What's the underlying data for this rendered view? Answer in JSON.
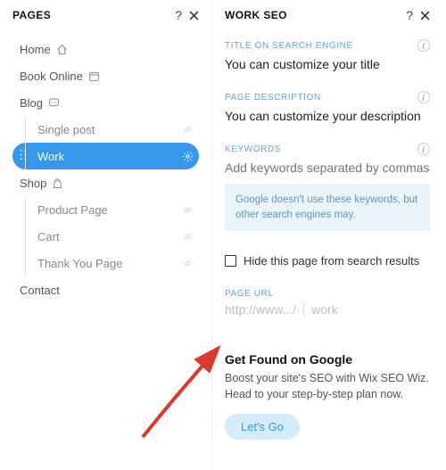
{
  "pages_panel": {
    "title": "PAGES",
    "items": [
      {
        "label": "Home",
        "icon": "home"
      },
      {
        "label": "Book Online",
        "icon": "calendar"
      },
      {
        "label": "Blog",
        "icon": "bubble"
      },
      {
        "label": "Single post",
        "child": true,
        "right_icon": "hidden"
      },
      {
        "label": "Work",
        "child": true,
        "selected": true,
        "right_icon": "gear"
      },
      {
        "label": "Shop",
        "icon": "bag"
      },
      {
        "label": "Product Page",
        "child": true,
        "right_icon": "hidden"
      },
      {
        "label": "Cart",
        "child": true,
        "right_icon": "hidden"
      },
      {
        "label": "Thank You Page",
        "child": true,
        "right_icon": "hidden"
      },
      {
        "label": "Contact"
      }
    ]
  },
  "seo_panel": {
    "title": "WORK SEO",
    "fields": {
      "title_label": "TITLE ON SEARCH ENGINE",
      "title_value": "You can customize your title",
      "desc_label": "PAGE DESCRIPTION",
      "desc_value": "You can customize your description",
      "keywords_label": "KEYWORDS",
      "keywords_placeholder": "Add keywords separated by commas",
      "keywords_note": "Google doesn't use these keywords, but other search engines may.",
      "hide_label": "Hide this page from search results",
      "url_label": "PAGE URL",
      "url_prefix": "http://www.../",
      "url_slug": "work"
    },
    "cta": {
      "title": "Get Found on Google",
      "desc": "Boost your site's SEO with Wix SEO Wiz. Head to your step-by-step plan now.",
      "button": "Let's Go"
    }
  },
  "icons": {
    "home": "home-icon",
    "calendar": "calendar-icon",
    "bubble": "bubble-icon",
    "bag": "bag-icon",
    "gear": "gear-icon",
    "hidden": "eye-off-icon",
    "help": "help-icon",
    "close": "close-icon",
    "info": "info-icon",
    "drag": "drag-handle-icon"
  }
}
